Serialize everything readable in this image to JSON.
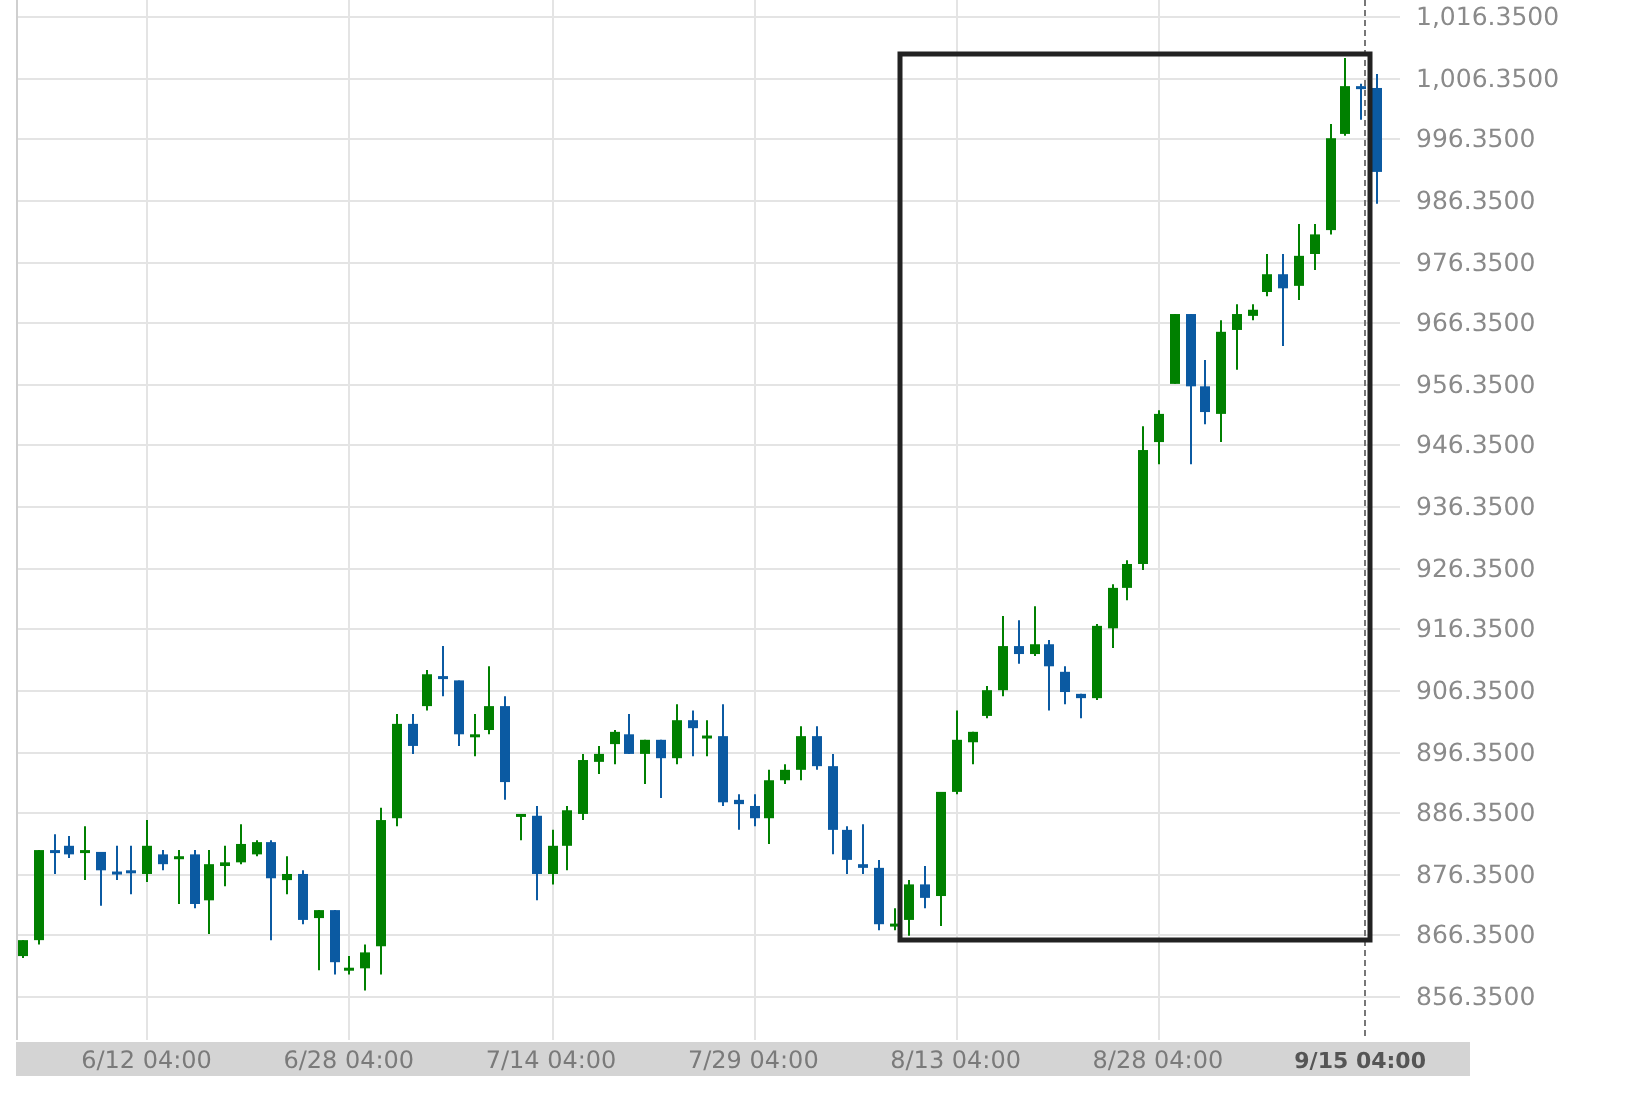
{
  "chart": {
    "chart_data": {
      "type": "candlestick",
      "categories": [
        null,
        null,
        null,
        null,
        null,
        null,
        null,
        null,
        "6/12 04:00",
        null,
        null,
        null,
        null,
        null,
        null,
        null,
        null,
        null,
        null,
        null,
        null,
        "6/28 04:00",
        null,
        null,
        null,
        null,
        null,
        null,
        null,
        null,
        null,
        null,
        null,
        null,
        "7/14 04:00",
        null,
        null,
        null,
        null,
        null,
        null,
        null,
        null,
        null,
        null,
        null,
        null,
        "7/29 04:00",
        null,
        null,
        null,
        null,
        null,
        null,
        null,
        null,
        null,
        null,
        null,
        null,
        "8/13 04:00",
        null,
        null,
        null,
        null,
        null,
        null,
        null,
        null,
        null,
        null,
        null,
        null,
        "8/28 04:00",
        null,
        null,
        null,
        null,
        null,
        null,
        null,
        null,
        null,
        null,
        null,
        null,
        "9/15 04:00",
        null
      ],
      "ylim": [
        849.2,
        1018.96
      ],
      "yticks": [
        {
          "value": 856.35,
          "label": "856.3500"
        },
        {
          "value": 866.35,
          "label": "866.3500"
        },
        {
          "value": 876.35,
          "label": "876.3500"
        },
        {
          "value": 886.35,
          "label": "886.3500"
        },
        {
          "value": 896.35,
          "label": "896.3500"
        },
        {
          "value": 906.35,
          "label": "906.3500"
        },
        {
          "value": 916.35,
          "label": "916.3500"
        },
        {
          "value": 926.35,
          "label": "926.3500"
        },
        {
          "value": 936.35,
          "label": "936.3500"
        },
        {
          "value": 946.35,
          "label": "946.3500"
        },
        {
          "value": 956.35,
          "label": "956.3500"
        },
        {
          "value": 966.35,
          "label": "966.3500"
        },
        {
          "value": 976.35,
          "label": "976.3500"
        },
        {
          "value": 986.35,
          "label": "986.3500"
        },
        {
          "value": 996.35,
          "label": "996.3500"
        },
        {
          "value": 1006.35,
          "label": "1,006.3500"
        },
        {
          "value": 1016.35,
          "label": "1,016.3500"
        }
      ],
      "ohlc": [
        [
          862.9,
          865.5,
          862.6,
          865.5
        ],
        [
          865.5,
          880.2,
          864.8,
          880.2
        ],
        [
          880.2,
          882.8,
          876.3,
          880.0
        ],
        [
          880.9,
          882.5,
          878.9,
          879.5
        ],
        [
          879.9,
          884.1,
          875.3,
          880.2
        ],
        [
          879.9,
          879.9,
          871.1,
          876.9
        ],
        [
          876.7,
          880.9,
          875.3,
          876.5
        ],
        [
          876.9,
          880.9,
          873.0,
          876.6
        ],
        [
          876.3,
          885.1,
          875.0,
          880.9
        ],
        [
          879.5,
          880.2,
          876.9,
          877.9
        ],
        [
          878.9,
          880.2,
          871.4,
          879.2
        ],
        [
          879.5,
          880.2,
          870.7,
          871.4
        ],
        [
          872.0,
          880.2,
          866.5,
          877.9
        ],
        [
          877.6,
          880.9,
          874.3,
          878.2
        ],
        [
          878.2,
          884.4,
          877.9,
          881.2
        ],
        [
          879.5,
          881.8,
          879.2,
          881.5
        ],
        [
          881.5,
          881.8,
          865.5,
          875.6
        ],
        [
          875.3,
          879.2,
          873.0,
          876.3
        ],
        [
          876.3,
          876.9,
          868.1,
          868.8
        ],
        [
          869.1,
          870.4,
          860.6,
          870.4
        ],
        [
          870.4,
          870.4,
          859.9,
          861.9
        ],
        [
          860.9,
          862.9,
          859.9,
          861.0
        ],
        [
          860.9,
          864.8,
          857.3,
          863.5
        ],
        [
          864.5,
          887.1,
          859.9,
          885.1
        ],
        [
          885.4,
          902.4,
          884.1,
          900.8
        ],
        [
          900.8,
          902.4,
          895.9,
          897.2
        ],
        [
          903.7,
          909.6,
          903.0,
          908.9
        ],
        [
          908.6,
          913.5,
          905.3,
          908.3
        ],
        [
          907.9,
          907.9,
          897.2,
          899.1
        ],
        [
          898.8,
          902.4,
          895.5,
          899.1
        ],
        [
          899.8,
          910.2,
          899.1,
          903.7
        ],
        [
          903.7,
          905.3,
          888.4,
          891.3
        ],
        [
          885.8,
          886.1,
          881.8,
          886.1
        ],
        [
          885.8,
          887.4,
          872.0,
          876.3
        ],
        [
          876.3,
          883.5,
          874.6,
          880.9
        ],
        [
          880.9,
          887.4,
          876.9,
          886.7
        ],
        [
          886.1,
          895.9,
          885.1,
          894.9
        ],
        [
          894.6,
          897.2,
          892.6,
          895.9
        ],
        [
          897.5,
          899.8,
          894.2,
          899.5
        ],
        [
          899.1,
          902.4,
          895.9,
          895.9
        ],
        [
          895.9,
          898.2,
          891.0,
          898.2
        ],
        [
          898.2,
          898.2,
          888.7,
          895.2
        ],
        [
          895.2,
          904.0,
          894.2,
          901.4
        ],
        [
          901.4,
          903.0,
          895.5,
          900.1
        ],
        [
          898.7,
          901.4,
          895.5,
          898.9
        ],
        [
          898.8,
          904.0,
          887.4,
          888.0
        ],
        [
          888.4,
          889.3,
          883.5,
          887.7
        ],
        [
          887.4,
          889.3,
          884.1,
          885.4
        ],
        [
          885.4,
          893.3,
          881.2,
          891.6
        ],
        [
          891.6,
          894.2,
          891.0,
          893.3
        ],
        [
          893.3,
          900.4,
          891.6,
          898.8
        ],
        [
          898.8,
          900.4,
          893.3,
          893.9
        ],
        [
          893.9,
          895.9,
          879.5,
          883.5
        ],
        [
          883.5,
          884.1,
          876.3,
          878.6
        ],
        [
          877.9,
          884.4,
          876.3,
          877.3
        ],
        [
          877.3,
          878.6,
          867.1,
          868.1
        ],
        [
          868.0,
          870.7,
          867.1,
          868.2
        ],
        [
          868.8,
          875.3,
          866.2,
          874.6
        ],
        [
          874.6,
          877.6,
          870.7,
          872.4
        ],
        [
          872.7,
          889.7,
          867.8,
          889.7
        ],
        [
          889.7,
          903.0,
          889.3,
          898.2
        ],
        [
          897.8,
          899.5,
          894.2,
          899.5
        ],
        [
          902.1,
          907.0,
          901.7,
          906.3
        ],
        [
          906.3,
          918.4,
          905.3,
          913.5
        ],
        [
          913.5,
          917.7,
          910.6,
          912.2
        ],
        [
          912.2,
          920.0,
          911.9,
          913.8
        ],
        [
          913.8,
          914.5,
          903.0,
          910.2
        ],
        [
          909.3,
          910.2,
          904.0,
          906.0
        ],
        [
          905.7,
          905.7,
          901.7,
          905.0
        ],
        [
          905.0,
          917.1,
          904.7,
          916.8
        ],
        [
          916.4,
          923.6,
          913.2,
          923.0
        ],
        [
          923.0,
          927.5,
          921.0,
          926.9
        ],
        [
          926.9,
          949.4,
          925.9,
          945.5
        ],
        [
          946.8,
          952.0,
          943.2,
          951.4
        ],
        [
          956.3,
          967.7,
          956.3,
          967.7
        ],
        [
          967.7,
          967.7,
          943.2,
          955.9
        ],
        [
          955.9,
          960.2,
          949.7,
          951.7
        ],
        [
          951.4,
          966.7,
          946.8,
          964.8
        ],
        [
          965.1,
          969.3,
          958.6,
          967.7
        ],
        [
          967.4,
          969.3,
          966.7,
          968.4
        ],
        [
          971.3,
          977.5,
          970.6,
          974.2
        ],
        [
          974.2,
          977.5,
          962.5,
          971.9
        ],
        [
          972.3,
          982.4,
          970.0,
          977.2
        ],
        [
          977.5,
          982.4,
          974.9,
          980.7
        ],
        [
          981.4,
          998.7,
          980.7,
          996.4
        ],
        [
          997.1,
          1009.5,
          996.8,
          1004.9
        ],
        [
          1004.9,
          1005.3,
          999.4,
          1004.6
        ],
        [
          1004.6,
          1006.9,
          985.7,
          990.9
        ]
      ],
      "grid": true,
      "ref_lines": [
        {
          "axis": "x",
          "value": "9/15 04:00"
        }
      ]
    }
  }
}
